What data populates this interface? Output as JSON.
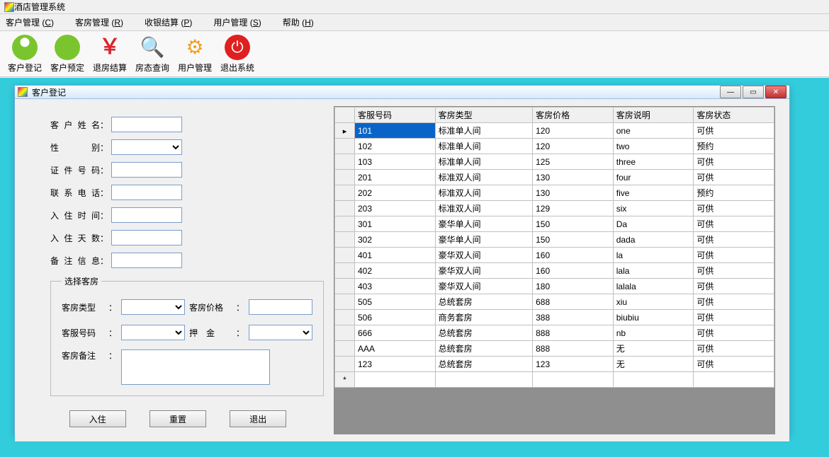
{
  "app_title": "酒店管理系统",
  "menubar": [
    {
      "label": "客户管理",
      "accel": "C"
    },
    {
      "label": "客房管理",
      "accel": "R"
    },
    {
      "label": "收银结算",
      "accel": "P"
    },
    {
      "label": "用户管理",
      "accel": "S"
    },
    {
      "label": "帮助",
      "accel": "H"
    }
  ],
  "toolbar": [
    {
      "name": "customer-register",
      "label": "客户登记",
      "icon": "person"
    },
    {
      "name": "customer-reserve",
      "label": "客户预定",
      "icon": "phone"
    },
    {
      "name": "checkout-settle",
      "label": "退房结算",
      "icon": "yen"
    },
    {
      "name": "room-status-query",
      "label": "房态查询",
      "icon": "search"
    },
    {
      "name": "user-manage",
      "label": "用户管理",
      "icon": "gear"
    },
    {
      "name": "exit-system",
      "label": "退出系统",
      "icon": "power"
    }
  ],
  "child": {
    "title": "客户登记",
    "form": {
      "name_label": "客户姓名",
      "gender_label": "性　　别",
      "id_label": "证件号码",
      "phone_label": "联系电话",
      "checkin_label": "入住时间",
      "days_label": "入住天数",
      "remark_label": "备注信息",
      "groupbox_title": "选择客房",
      "room_type_label": "客房类型",
      "room_price_label": "客房价格",
      "room_no_label": "客服号码",
      "deposit_label": "押　金",
      "room_remark_label": "客房备注",
      "btn_checkin": "入住",
      "btn_reset": "重置",
      "btn_exit": "退出",
      "values": {
        "name": "",
        "gender": "",
        "id": "",
        "phone": "",
        "checkin": "",
        "days": "",
        "remark": "",
        "room_type": "",
        "room_price": "",
        "room_no": "",
        "deposit": "",
        "room_remark": ""
      }
    },
    "grid": {
      "columns": [
        "客服号码",
        "客房类型",
        "客房价格",
        "客房说明",
        "客房状态"
      ],
      "rows": [
        [
          "101",
          "标准单人间",
          "120",
          "one",
          "可供"
        ],
        [
          "102",
          "标准单人间",
          "120",
          "two",
          "预约"
        ],
        [
          "103",
          "标准单人间",
          "125",
          "three",
          "可供"
        ],
        [
          "201",
          "标准双人间",
          "130",
          "four",
          "可供"
        ],
        [
          "202",
          "标准双人间",
          "130",
          "five",
          "预约"
        ],
        [
          "203",
          "标准双人间",
          "129",
          "six",
          "可供"
        ],
        [
          "301",
          "豪华单人间",
          "150",
          "Da",
          "可供"
        ],
        [
          "302",
          "豪华单人间",
          "150",
          "dada",
          "可供"
        ],
        [
          "401",
          "豪华双人间",
          "160",
          "la",
          "可供"
        ],
        [
          "402",
          "豪华双人间",
          "160",
          "lala",
          "可供"
        ],
        [
          "403",
          "豪华双人间",
          "180",
          "lalala",
          "可供"
        ],
        [
          "505",
          "总统套房",
          "688",
          "xiu",
          "可供"
        ],
        [
          "506",
          "商务套房",
          "388",
          "biubiu",
          "可供"
        ],
        [
          "666",
          "总统套房",
          "888",
          "nb",
          "可供"
        ],
        [
          "AAA",
          "总统套房",
          "888",
          "无",
          "可供"
        ],
        [
          "123",
          "总统套房",
          "123",
          "无",
          "可供"
        ]
      ]
    }
  }
}
